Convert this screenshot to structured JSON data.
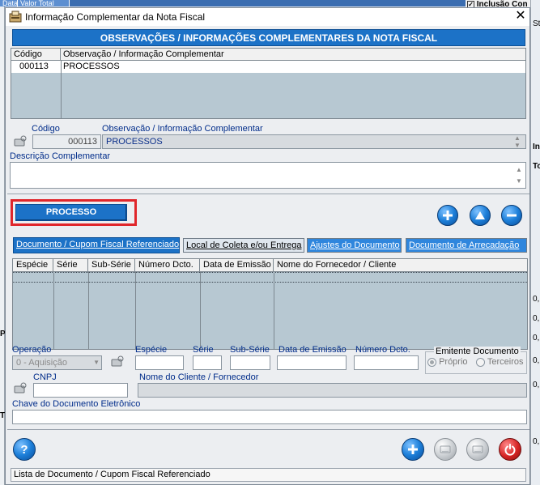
{
  "background": {
    "tabs": [
      "Data",
      "Valor Total"
    ],
    "top_right": "Inclusão Con",
    "right_fragments": [
      "St",
      "In",
      "To",
      "0,",
      "0,",
      "0,",
      "0,",
      "0,",
      "0,"
    ],
    "left_fragments": [
      "P",
      "T"
    ]
  },
  "dialog": {
    "title": "Informação Complementar da Nota Fiscal",
    "close_label": "✕",
    "header": "OBSERVAÇÕES / INFORMAÇÕES COMPLEMENTARES DA NOTA FISCAL",
    "grid1": {
      "columns": [
        "Código",
        "Observação / Informação Complementar"
      ],
      "rows": [
        {
          "codigo": "000113",
          "obs": "PROCESSOS"
        }
      ]
    },
    "codigo_label": "Código",
    "codigo_value": "000113",
    "obs_label": "Observação / Informação Complementar",
    "obs_value": "PROCESSOS",
    "descricao_label": "Descrição Complementar",
    "descricao_value": "",
    "processo_button": "PROCESSO",
    "tabs": [
      "Documento / Cupom Fiscal Referenciado",
      "Local de Coleta e/ou Entrega",
      "Ajustes do Documento",
      "Documento de Arrecadação"
    ],
    "grid2_columns": [
      "Espécie",
      "Série",
      "Sub-Série",
      "Número Dcto.",
      "Data de Emissão",
      "Nome do Fornecedor / Cliente"
    ],
    "form": {
      "operacao_label": "Operação",
      "operacao_value": "0 - Aquisição",
      "especie_label": "Espécie",
      "serie_label": "Série",
      "subserie_label": "Sub-Série",
      "data_label": "Data de Emissão",
      "numero_label": "Número Dcto.",
      "emitente_label": "Emitente Documento",
      "proprio_label": "Próprio",
      "terceiros_label": "Terceiros",
      "cnpj_label": "CNPJ",
      "nome_label": "Nome do Cliente / Fornecedor",
      "chave_label": "Chave do Documento Eletrônico"
    },
    "status_text": "Lista de Documento / Cupom Fiscal Referenciado",
    "help_glyph": "?"
  },
  "colors": {
    "accent": "#1c72c7",
    "highlight_border": "#e0262b",
    "grid_bg": "#b7c8d2"
  }
}
